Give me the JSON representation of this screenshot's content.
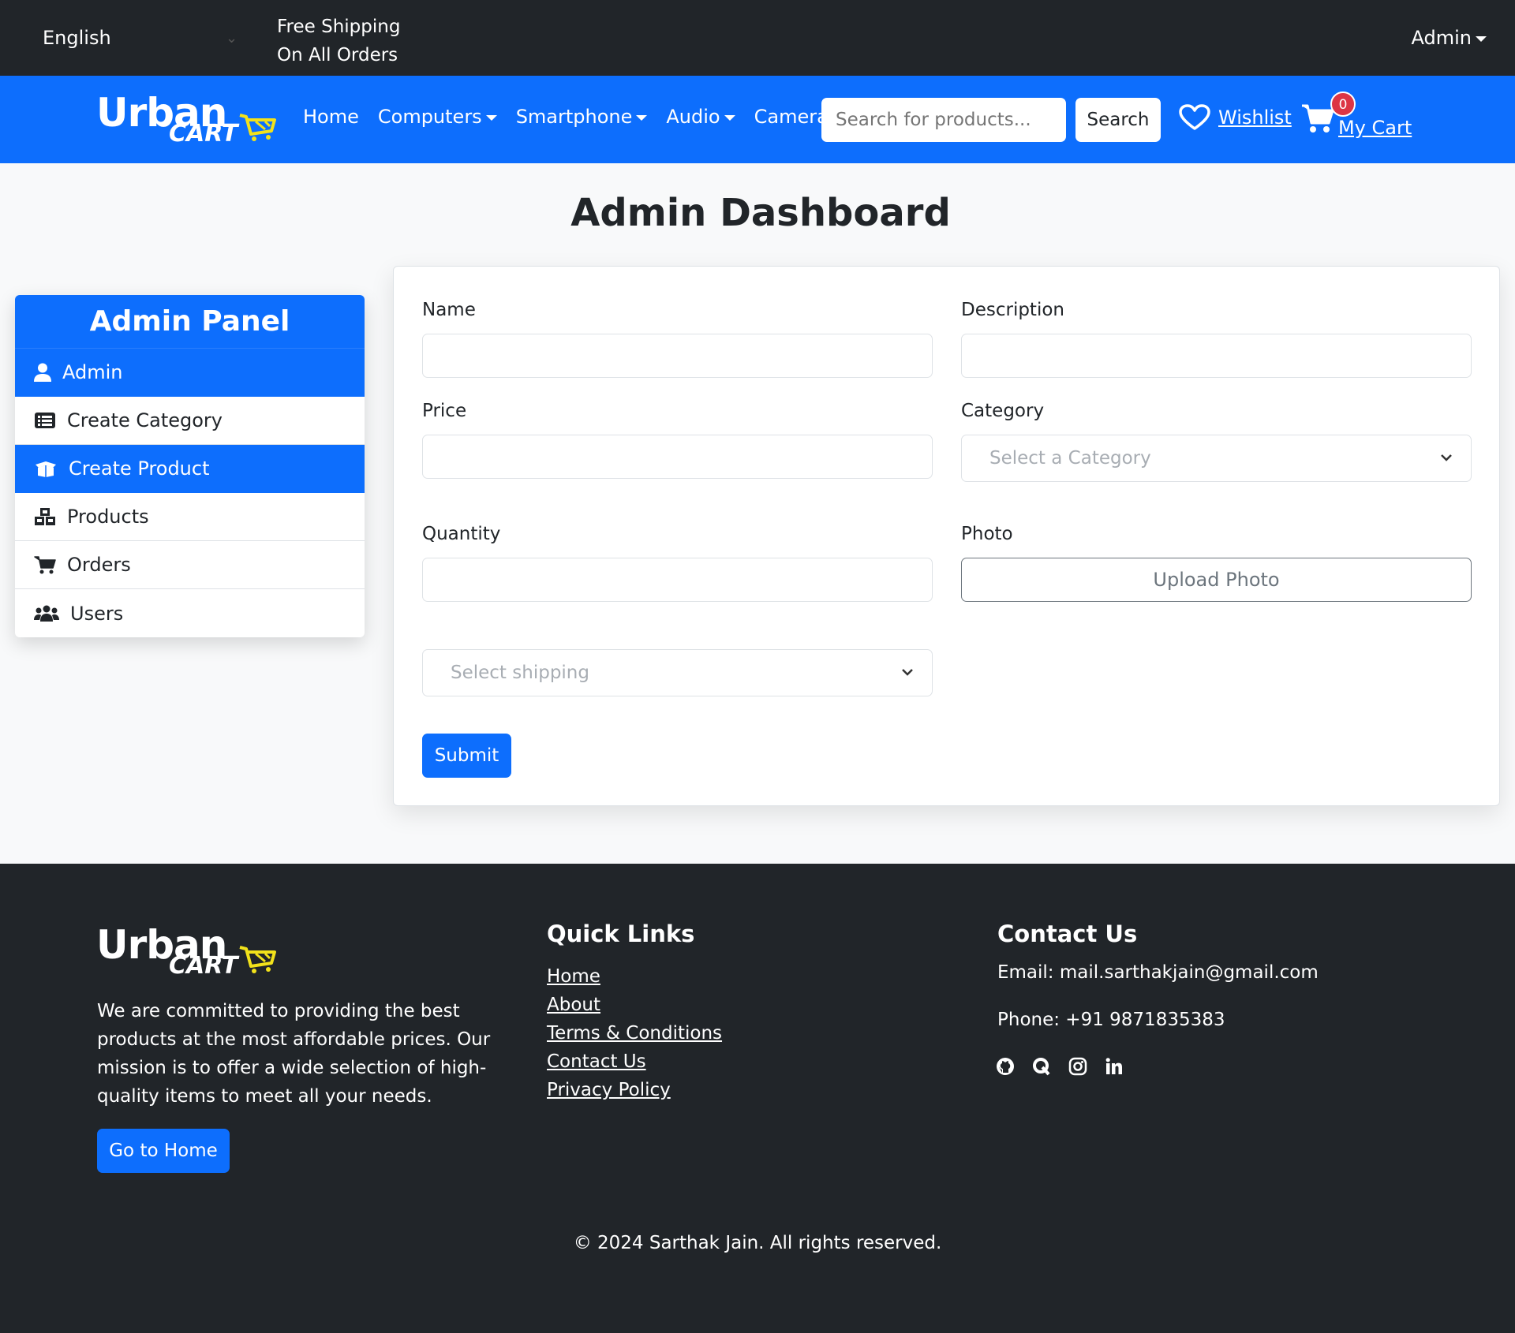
{
  "topbar": {
    "language": "English",
    "promo_line1": "Free Shipping",
    "promo_line2": "On All Orders",
    "admin": "Admin"
  },
  "navbar": {
    "brand_top": "Urban",
    "brand_bottom": "CART",
    "links": [
      "Home",
      "Computers",
      "Smartphone",
      "Audio",
      "Camera"
    ],
    "search_placeholder": "Search for products...",
    "search_button": "Search",
    "wishlist": "Wishlist",
    "cart": "My Cart",
    "cart_count": "0"
  },
  "page": {
    "title": "Admin Dashboard"
  },
  "admin_panel": {
    "title": "Admin Panel",
    "items": [
      {
        "label": "Admin",
        "icon": "user-icon",
        "active": true
      },
      {
        "label": "Create Category",
        "icon": "list-icon",
        "active": false
      },
      {
        "label": "Create Product",
        "icon": "box-open-icon",
        "active": true
      },
      {
        "label": "Products",
        "icon": "cubes-icon",
        "active": false
      },
      {
        "label": "Orders",
        "icon": "cart-icon",
        "active": false
      },
      {
        "label": "Users",
        "icon": "users-icon",
        "active": false
      }
    ]
  },
  "form": {
    "name_label": "Name",
    "description_label": "Description",
    "price_label": "Price",
    "category_label": "Category",
    "category_placeholder": "Select a Category",
    "quantity_label": "Quantity",
    "photo_label": "Photo",
    "upload_label": "Upload Photo",
    "shipping_placeholder": "Select shipping",
    "submit_label": "Submit"
  },
  "footer": {
    "about": "We are committed to providing the best products at the most affordable prices. Our mission is to offer a wide selection of high-quality items to meet all your needs.",
    "home_button": "Go to Home",
    "quick_links_title": "Quick Links",
    "quick_links": [
      "Home",
      "About",
      "Terms & Conditions",
      "Contact Us",
      "Privacy Policy"
    ],
    "contact_title": "Contact Us",
    "email": "Email: mail.sarthakjain@gmail.com",
    "phone": "Phone: +91 9871835383",
    "socials": [
      "github-icon",
      "quora-icon",
      "instagram-icon",
      "linkedin-icon"
    ],
    "copyright": "© 2024 Sarthak Jain. All rights reserved."
  },
  "colors": {
    "primary": "#0d6efd",
    "dark": "#212529",
    "badge": "#dc3545",
    "logo_accent": "#f2e21b"
  }
}
